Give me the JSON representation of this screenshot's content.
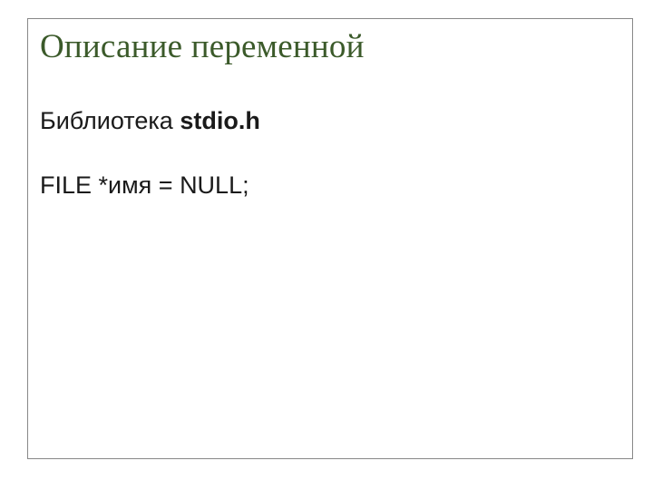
{
  "slide": {
    "title": "Описание переменной",
    "line1_prefix": "Библиотека ",
    "line1_bold": "stdio.h",
    "line2": "FILE *имя = NULL;"
  }
}
